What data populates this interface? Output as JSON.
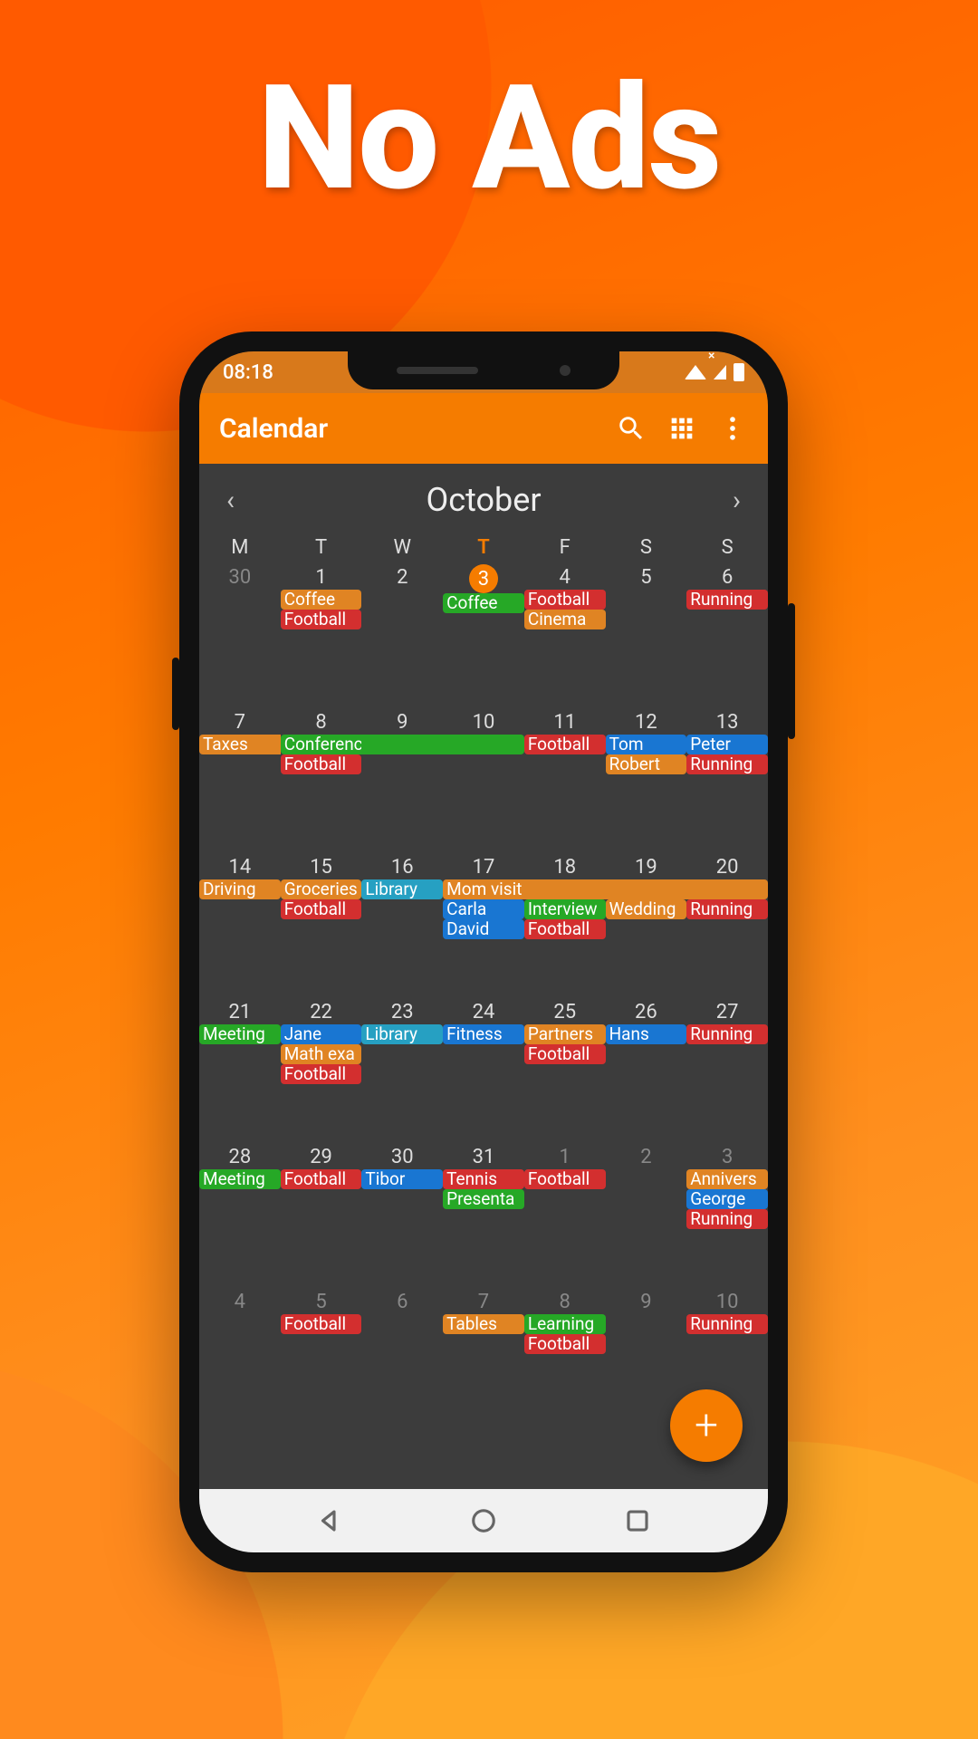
{
  "promo_title": "No Ads",
  "status": {
    "time": "08:18"
  },
  "appbar": {
    "title": "Calendar"
  },
  "month": {
    "name": "October",
    "prev": "‹",
    "next": "›"
  },
  "weekdays": [
    "M",
    "T",
    "W",
    "T",
    "F",
    "S",
    "S"
  ],
  "today_weekday_index": 3,
  "fab": {
    "glyph": "+"
  },
  "colors": {
    "orange": "#e08423",
    "red": "#d32f2f",
    "green": "#26a826",
    "blue": "#1976d2",
    "cyan": "#26a0c2"
  },
  "weeks": [
    [
      {
        "num": "30",
        "dim": true,
        "events": []
      },
      {
        "num": "1",
        "events": [
          {
            "t": "Coffee",
            "c": "orange"
          },
          {
            "t": "Football",
            "c": "red"
          }
        ]
      },
      {
        "num": "2",
        "events": []
      },
      {
        "num": "3",
        "today": true,
        "events": [
          {
            "t": "Coffee",
            "c": "green"
          }
        ]
      },
      {
        "num": "4",
        "events": [
          {
            "t": "Football",
            "c": "red"
          },
          {
            "t": "Cinema",
            "c": "orange"
          }
        ]
      },
      {
        "num": "5",
        "events": []
      },
      {
        "num": "6",
        "events": [
          {
            "t": "Running",
            "c": "red"
          }
        ]
      }
    ],
    [
      {
        "num": "7",
        "events": [
          {
            "t": "Taxes",
            "c": "orange",
            "span": "right"
          }
        ]
      },
      {
        "num": "8",
        "events": [
          {
            "t": "Conference",
            "c": "green",
            "span": "right"
          },
          {
            "t": "Football",
            "c": "red"
          }
        ]
      },
      {
        "num": "9",
        "events": [
          {
            "t": "",
            "c": "green",
            "span": "both"
          }
        ]
      },
      {
        "num": "10",
        "events": [
          {
            "t": "",
            "c": "green",
            "span": "left"
          }
        ]
      },
      {
        "num": "11",
        "events": [
          {
            "t": "Football",
            "c": "red"
          }
        ]
      },
      {
        "num": "12",
        "events": [
          {
            "t": "Tom",
            "c": "blue"
          },
          {
            "t": "Robert",
            "c": "orange"
          }
        ]
      },
      {
        "num": "13",
        "events": [
          {
            "t": "Peter",
            "c": "blue"
          },
          {
            "t": "Running",
            "c": "red"
          }
        ]
      }
    ],
    [
      {
        "num": "14",
        "events": [
          {
            "t": "Driving",
            "c": "orange"
          }
        ]
      },
      {
        "num": "15",
        "events": [
          {
            "t": "Groceries",
            "c": "orange"
          },
          {
            "t": "Football",
            "c": "red"
          }
        ]
      },
      {
        "num": "16",
        "events": [
          {
            "t": "Library",
            "c": "cyan"
          }
        ]
      },
      {
        "num": "17",
        "events": [
          {
            "t": "Mom visit",
            "c": "orange",
            "span": "right"
          },
          {
            "t": "Carla",
            "c": "blue"
          },
          {
            "t": "David",
            "c": "blue"
          }
        ]
      },
      {
        "num": "18",
        "events": [
          {
            "t": "",
            "c": "orange",
            "span": "both"
          },
          {
            "t": "Interview",
            "c": "green"
          },
          {
            "t": "Football",
            "c": "red"
          }
        ]
      },
      {
        "num": "19",
        "events": [
          {
            "t": "",
            "c": "orange",
            "span": "both"
          },
          {
            "t": "Wedding",
            "c": "orange"
          }
        ]
      },
      {
        "num": "20",
        "events": [
          {
            "t": "",
            "c": "orange",
            "span": "left"
          },
          {
            "t": "Running",
            "c": "red"
          }
        ]
      }
    ],
    [
      {
        "num": "21",
        "events": [
          {
            "t": "Meeting",
            "c": "green"
          }
        ]
      },
      {
        "num": "22",
        "events": [
          {
            "t": "Jane",
            "c": "blue"
          },
          {
            "t": "Math exa",
            "c": "orange"
          },
          {
            "t": "Football",
            "c": "red"
          }
        ]
      },
      {
        "num": "23",
        "events": [
          {
            "t": "Library",
            "c": "cyan"
          }
        ]
      },
      {
        "num": "24",
        "events": [
          {
            "t": "Fitness",
            "c": "blue"
          }
        ]
      },
      {
        "num": "25",
        "events": [
          {
            "t": "Partners",
            "c": "orange"
          },
          {
            "t": "Football",
            "c": "red"
          }
        ]
      },
      {
        "num": "26",
        "events": [
          {
            "t": "Hans",
            "c": "blue"
          }
        ]
      },
      {
        "num": "27",
        "events": [
          {
            "t": "Running",
            "c": "red"
          }
        ]
      }
    ],
    [
      {
        "num": "28",
        "events": [
          {
            "t": "Meeting",
            "c": "green"
          }
        ]
      },
      {
        "num": "29",
        "events": [
          {
            "t": "Football",
            "c": "red"
          }
        ]
      },
      {
        "num": "30",
        "events": [
          {
            "t": "Tibor",
            "c": "blue"
          }
        ]
      },
      {
        "num": "31",
        "events": [
          {
            "t": "Tennis",
            "c": "red"
          },
          {
            "t": "Presenta",
            "c": "green"
          }
        ]
      },
      {
        "num": "1",
        "dim": true,
        "events": [
          {
            "t": "Football",
            "c": "red"
          }
        ]
      },
      {
        "num": "2",
        "dim": true,
        "events": []
      },
      {
        "num": "3",
        "dim": true,
        "events": [
          {
            "t": "Annivers",
            "c": "orange"
          },
          {
            "t": "George",
            "c": "blue"
          },
          {
            "t": "Running",
            "c": "red"
          }
        ]
      }
    ],
    [
      {
        "num": "4",
        "dim": true,
        "events": []
      },
      {
        "num": "5",
        "dim": true,
        "events": [
          {
            "t": "Football",
            "c": "red"
          }
        ]
      },
      {
        "num": "6",
        "dim": true,
        "events": []
      },
      {
        "num": "7",
        "dim": true,
        "events": [
          {
            "t": "Tables",
            "c": "orange"
          }
        ]
      },
      {
        "num": "8",
        "dim": true,
        "events": [
          {
            "t": "Learning",
            "c": "green"
          },
          {
            "t": "Football",
            "c": "red"
          }
        ]
      },
      {
        "num": "9",
        "dim": true,
        "events": []
      },
      {
        "num": "10",
        "dim": true,
        "events": [
          {
            "t": "Running",
            "c": "red"
          }
        ]
      }
    ]
  ]
}
